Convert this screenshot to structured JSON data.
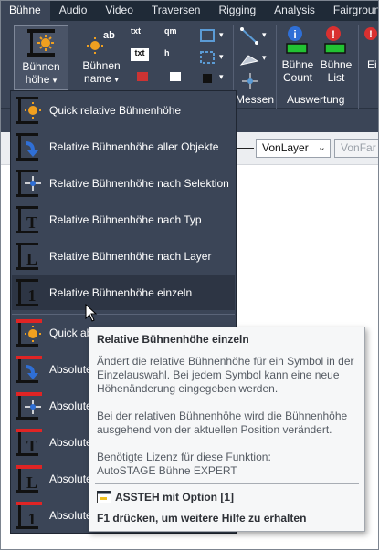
{
  "tabs": [
    "Bühne",
    "Audio",
    "Video",
    "Traversen",
    "Rigging",
    "Analysis",
    "Fairground"
  ],
  "active_tab": "Bühne",
  "ribbon": {
    "btn_buehnenhoehe_line1": "Bühnen",
    "btn_buehnenhoehe_line2": "höhe",
    "btn_buehnenname_line1": "Bühnen",
    "btn_buehnenname_line2": "name",
    "small_txt1": "txt",
    "small_qm": "qm",
    "small_txt2": "txt",
    "small_h": "h",
    "group_messen": "Messen",
    "btn_count_line1": "Bühne",
    "btn_count_line2": "Count",
    "btn_list_line1": "Bühne",
    "btn_list_line2": "List",
    "group_auswertung": "Auswertung",
    "btn_cut": "Ei"
  },
  "properties": {
    "layer_value": "VonLayer",
    "layer2_value": "VonFar"
  },
  "menu_items": [
    "Quick relative Bühnenhöhe",
    "Relative Bühnenhöhe aller Objekte",
    "Relative Bühnenhöhe nach Selektion",
    "Relative Bühnenhöhe nach Typ",
    "Relative Bühnenhöhe nach Layer",
    "Relative Bühnenhöhe einzeln",
    "Quick ab",
    "Absolute",
    "Absolute",
    "Absolute",
    "Absolute",
    "Absolute"
  ],
  "tooltip": {
    "title": "Relative Bühnenhöhe einzeln",
    "desc_line1": "Ändert die relative Bühnenhöhe für ein Symbol in der",
    "desc_line2": "Einzelauswahl. Bei jedem Symbol kann eine neue",
    "desc_line3": "Höhenänderung eingegeben werden.",
    "note_line1": "Bei der relativen Bühnenhöhe wird die Bühnenhöhe",
    "note_line2": "ausgehend von der aktuellen Position verändert.",
    "license_line1": "Benötigte Lizenz für diese Funktion:",
    "license_line2": "AutoSTAGE Bühne EXPERT",
    "command": "ASSTEH mit Option [1]",
    "help": "F1 drücken, um weitere Hilfe zu erhalten"
  },
  "colors": {
    "accent_red": "#e02424",
    "ribbon_bg": "#3b4557",
    "tab_bg": "#1f2a37"
  },
  "icons": {
    "menu_quick": "sun-height-icon",
    "menu_all": "arrow-height-icon",
    "menu_selection": "crosshair-height-icon",
    "menu_type": "type-t-height-icon",
    "menu_layer": "layer-l-height-icon",
    "menu_single": "single-1-height-icon"
  }
}
